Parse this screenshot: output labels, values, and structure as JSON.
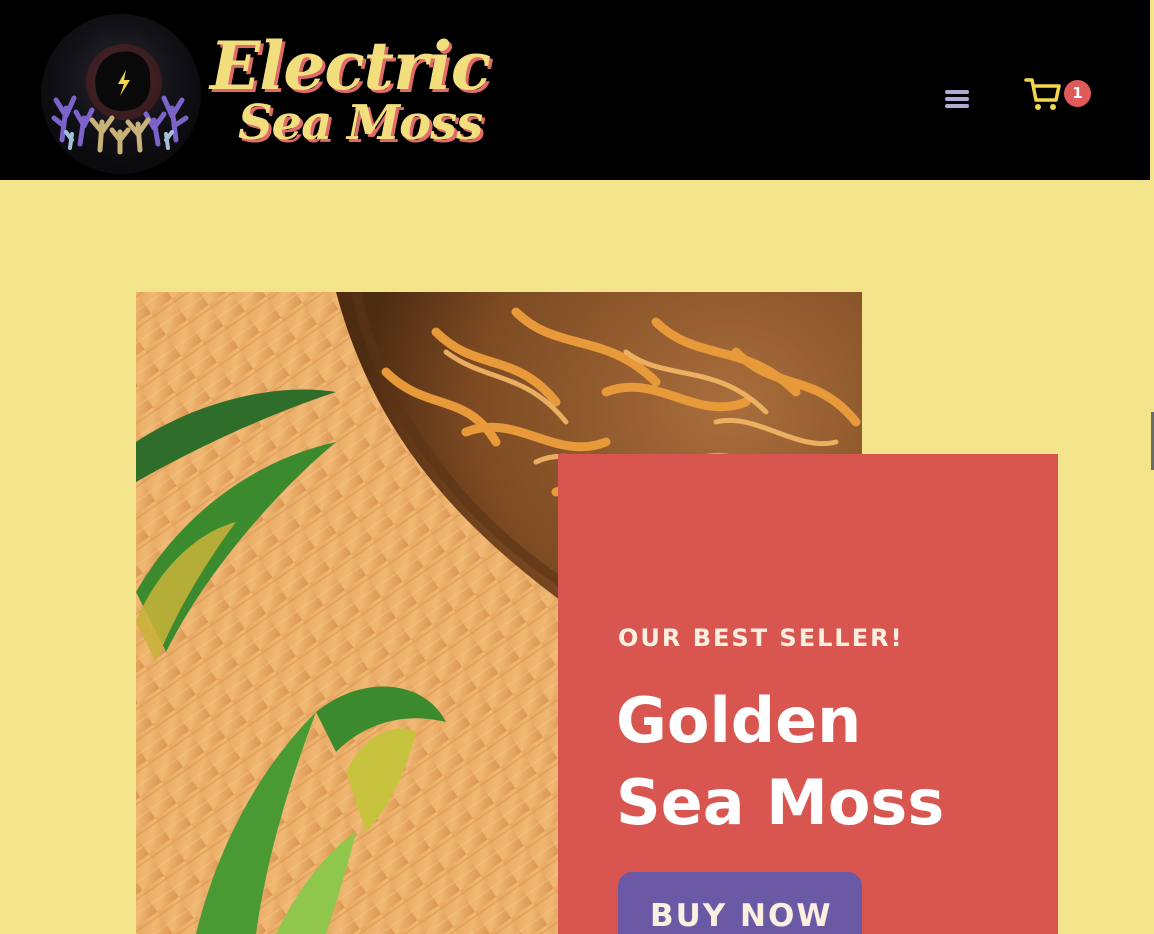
{
  "brand": {
    "line1": "Electric",
    "line2": "Sea Moss",
    "badge_icon": "coral-lightning-logo"
  },
  "header": {
    "menu_icon": "hamburger-menu-icon",
    "cart_icon": "shopping-cart-icon",
    "cart_count": "1"
  },
  "hero": {
    "image_subject": "golden-sea-moss-bowl-photo"
  },
  "promo": {
    "eyebrow": "OUR BEST SELLER!",
    "title_line1": "Golden",
    "title_line2": "Sea Moss",
    "button_label": "BUY NOW"
  },
  "colors": {
    "page_bg": "#f3e38a",
    "header_bg": "#000000",
    "logo_yellow": "#f3de7e",
    "logo_shadow": "#e06a6a",
    "cart_yellow": "#f3d64a",
    "badge_red": "#df5a58",
    "card_red": "#d95650",
    "button_purple": "#6a5aa6",
    "menu_lavender": "#b1a9d3"
  }
}
